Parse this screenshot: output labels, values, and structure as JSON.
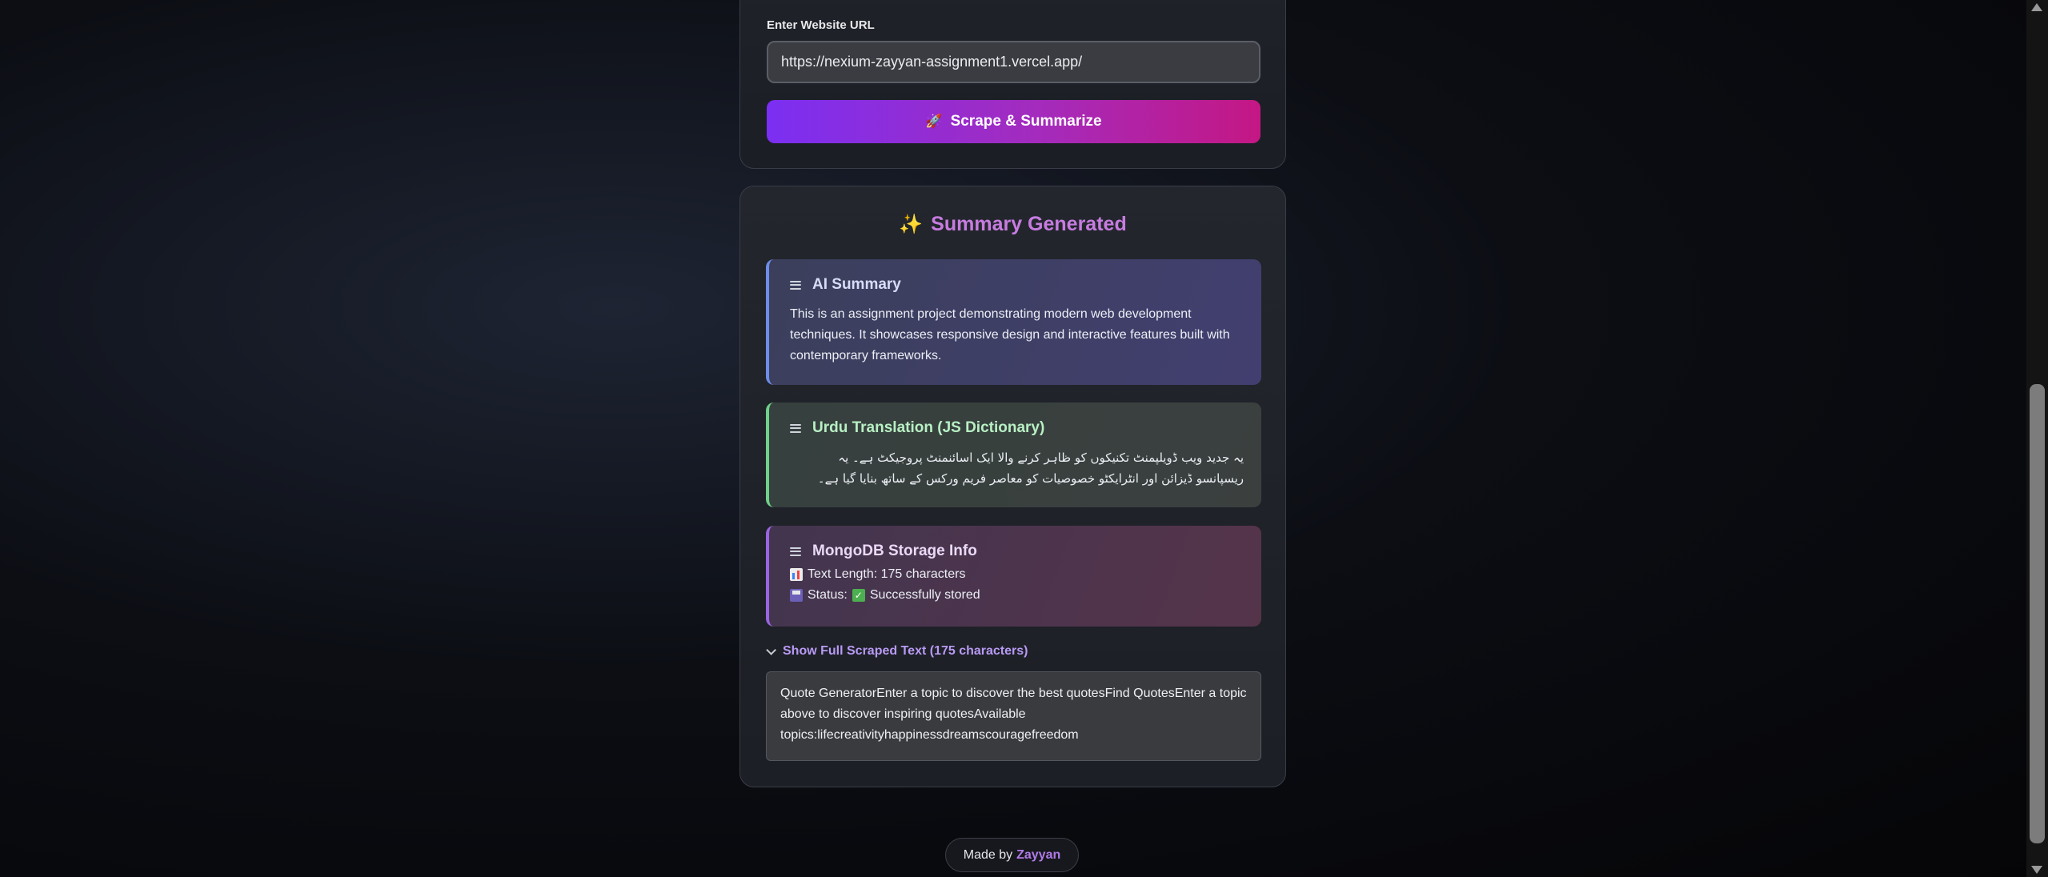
{
  "form": {
    "url_label": "Enter Website URL",
    "url_value": "https://nexium-zayyan-assignment1.vercel.app/",
    "submit_icon": "rocket-icon",
    "submit_label": "Scrape & Summarize"
  },
  "summary": {
    "title_icon": "sparkles-icon",
    "title": "Summary Generated",
    "ai": {
      "title": "AI Summary",
      "text": "This is an assignment project demonstrating modern web development techniques. It showcases responsive design and interactive features built with contemporary frameworks."
    },
    "urdu": {
      "title": "Urdu Translation (JS Dictionary)",
      "text": "یہ جدید ویب ڈویلپمنٹ تکنیکوں کو ظاہر کرنے والا ایک اسائنمنٹ پروجیکٹ ہے۔ یہ ریسپانسو ڈیزائن اور انٹرایکٹو خصوصیات کو معاصر فریم ورکس کے ساتھ بنایا گیا ہے۔"
    },
    "mongo": {
      "title": "MongoDB Storage Info",
      "length_label": "Text Length: 175 characters",
      "status_label": "Status:",
      "status_value": "Successfully stored"
    },
    "toggle_label": "Show Full Scraped Text (175 characters)",
    "scraped_text": "Quote GeneratorEnter a topic to discover the best quotesFind QuotesEnter a topic above to discover inspiring quotesAvailable topics:lifecreativityhappinessdreamscouragefreedom"
  },
  "footer": {
    "prefix": "Made by",
    "author": "Zayyan"
  },
  "colors": {
    "accent_purple": "#7b2ff2",
    "accent_pink": "#c41784",
    "title_color": "#c77ce0",
    "link_color": "#b17ae8"
  }
}
